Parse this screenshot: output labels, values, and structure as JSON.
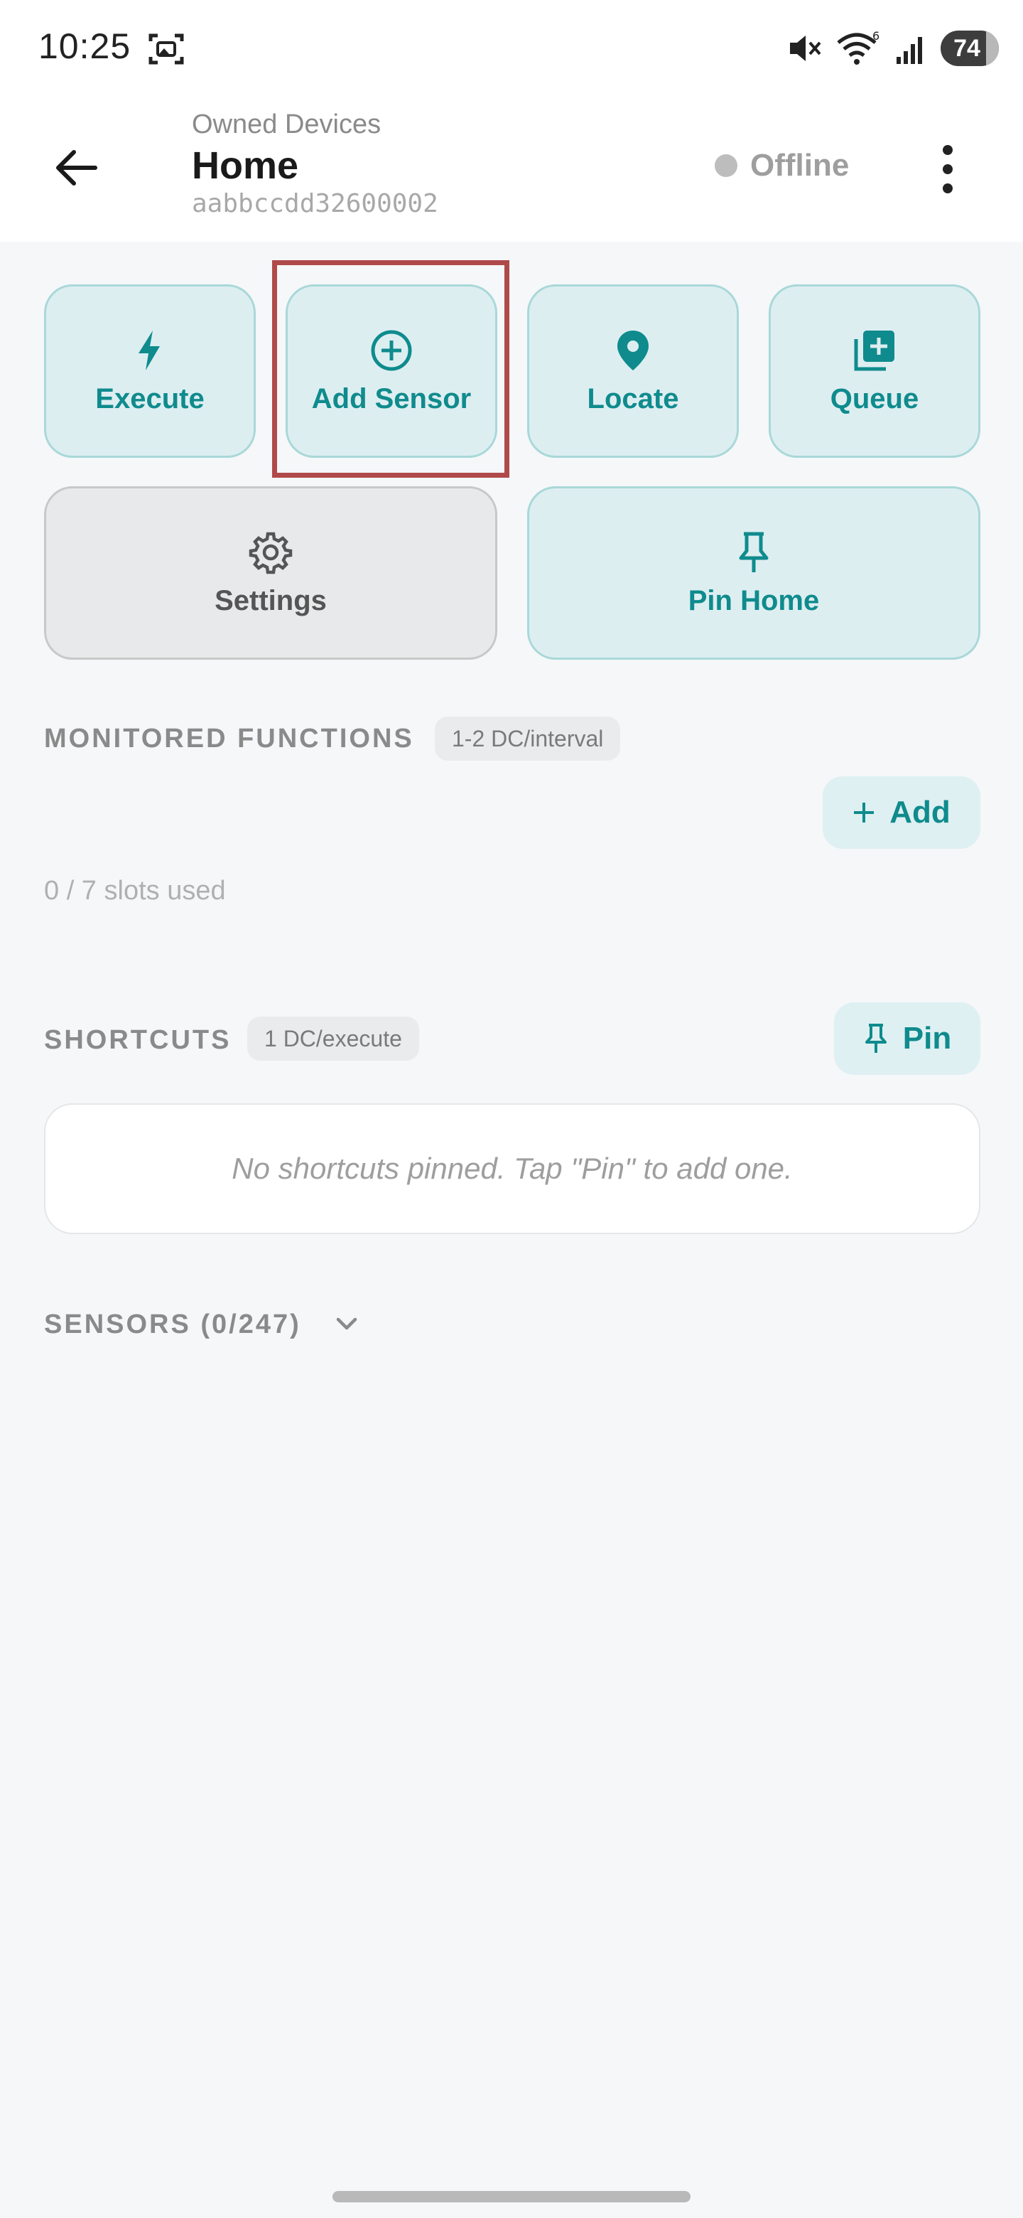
{
  "status_bar": {
    "time": "10:25",
    "battery": "74"
  },
  "header": {
    "subtitle": "Owned Devices",
    "title": "Home",
    "device_id": "aabbccdd32600002",
    "status": "Offline"
  },
  "actions": {
    "execute": "Execute",
    "add_sensor": "Add Sensor",
    "locate": "Locate",
    "queue": "Queue",
    "settings": "Settings",
    "pin_home": "Pin Home"
  },
  "monitored": {
    "title": "MONITORED FUNCTIONS",
    "chip": "1-2 DC/interval",
    "add_label": "Add",
    "slots": "0 / 7 slots used"
  },
  "shortcuts": {
    "title": "SHORTCUTS",
    "chip": "1 DC/execute",
    "pin_label": "Pin",
    "empty": "No shortcuts pinned. Tap \"Pin\" to add one."
  },
  "sensors": {
    "title": "SENSORS (0/247)"
  },
  "colors": {
    "accent": "#0f8b8d",
    "card_bg": "#ddeef1",
    "highlight": "#b04a4a",
    "offline": "#bdbdbd"
  }
}
